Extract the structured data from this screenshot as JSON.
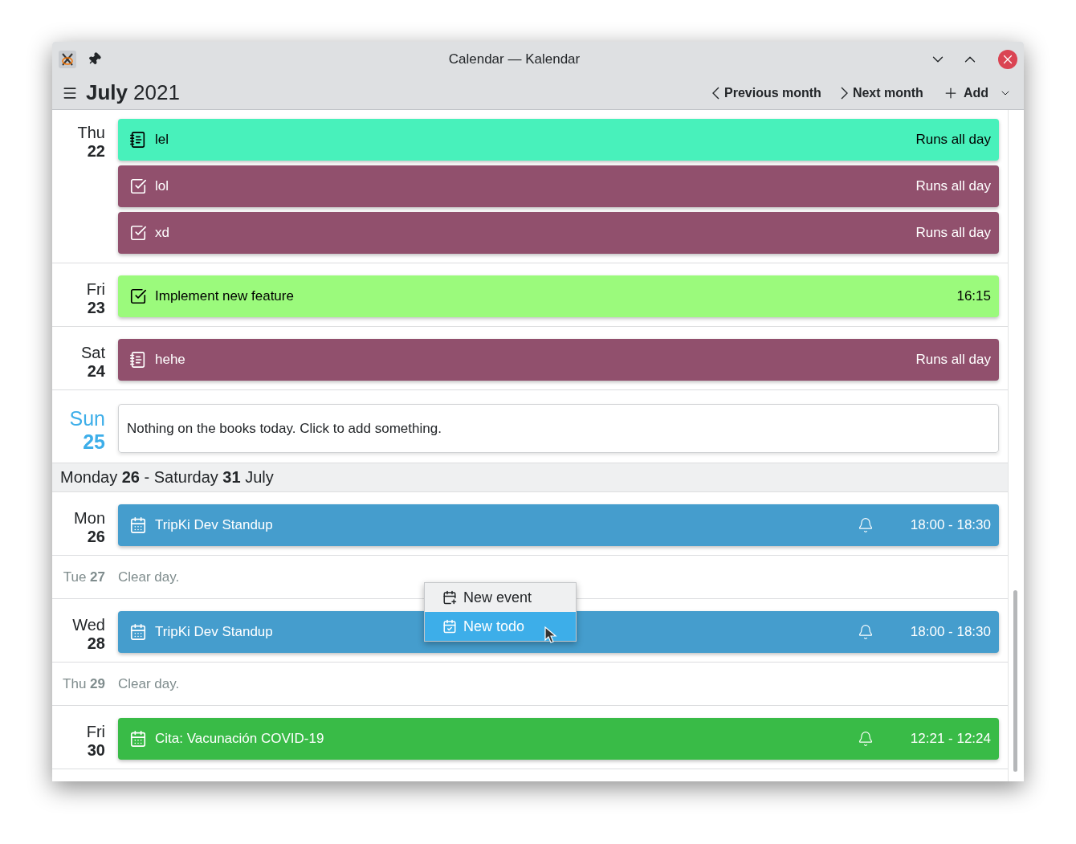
{
  "window": {
    "title": "Calendar — Kalendar"
  },
  "header": {
    "month": "July",
    "year": "2021",
    "actions": [
      {
        "label": "Previous month",
        "kind": "prev"
      },
      {
        "label": "Next month",
        "kind": "next"
      },
      {
        "label": "Add",
        "kind": "add"
      }
    ]
  },
  "agenda": [
    {
      "kind": "day",
      "weekday": "Thu",
      "date": "22",
      "today": false,
      "events": [
        {
          "kind": "journal",
          "title": "lel",
          "time": "Runs all day",
          "color": "#48f1bb",
          "alarm": false
        },
        {
          "kind": "todo",
          "title": "lol",
          "time": "Runs all day",
          "color": "#91506d",
          "alarm": false
        },
        {
          "kind": "todo",
          "title": "xd",
          "time": "Runs all day",
          "color": "#91506d",
          "alarm": false
        }
      ]
    },
    {
      "kind": "day",
      "weekday": "Fri",
      "date": "23",
      "today": false,
      "events": [
        {
          "kind": "todo",
          "title": "Implement new feature",
          "time": "16:15",
          "color": "#9bfa7c",
          "alarm": false
        }
      ]
    },
    {
      "kind": "day",
      "weekday": "Sat",
      "date": "24",
      "today": false,
      "events": [
        {
          "kind": "journal",
          "title": "hehe",
          "time": "Runs all day",
          "color": "#91506d",
          "alarm": false
        }
      ]
    },
    {
      "kind": "empty_day",
      "weekday": "Sun",
      "date": "25",
      "today": true,
      "note": "Nothing on the books today. Click to add something."
    },
    {
      "kind": "week",
      "label": "Monday **26** - Saturday **31** July"
    },
    {
      "kind": "day",
      "weekday": "Mon",
      "date": "26",
      "today": false,
      "events": [
        {
          "kind": "event",
          "title": "TripKi Dev Standup",
          "time": "18:00 - 18:30",
          "color": "#459dcd",
          "alarm": true
        }
      ]
    },
    {
      "kind": "clear_day",
      "weekday": "Tue",
      "date": "27",
      "today": false,
      "note": "Clear day."
    },
    {
      "kind": "day",
      "weekday": "Wed",
      "date": "28",
      "today": false,
      "events": [
        {
          "kind": "event",
          "title": "TripKi Dev Standup",
          "time": "18:00 - 18:30",
          "color": "#459dcd",
          "alarm": true
        }
      ]
    },
    {
      "kind": "clear_day",
      "weekday": "Thu",
      "date": "29",
      "today": false,
      "note": "Clear day."
    },
    {
      "kind": "day",
      "weekday": "Fri",
      "date": "30",
      "today": false,
      "events": [
        {
          "kind": "event",
          "title": "Cita: Vacunación COVID-19",
          "time": "12:21 - 12:24",
          "color": "#39bb47",
          "alarm": true
        }
      ]
    }
  ],
  "context_menu": [
    {
      "label": "New event",
      "kind": "event",
      "selected": false
    },
    {
      "label": "New todo",
      "kind": "todo",
      "selected": true
    }
  ]
}
